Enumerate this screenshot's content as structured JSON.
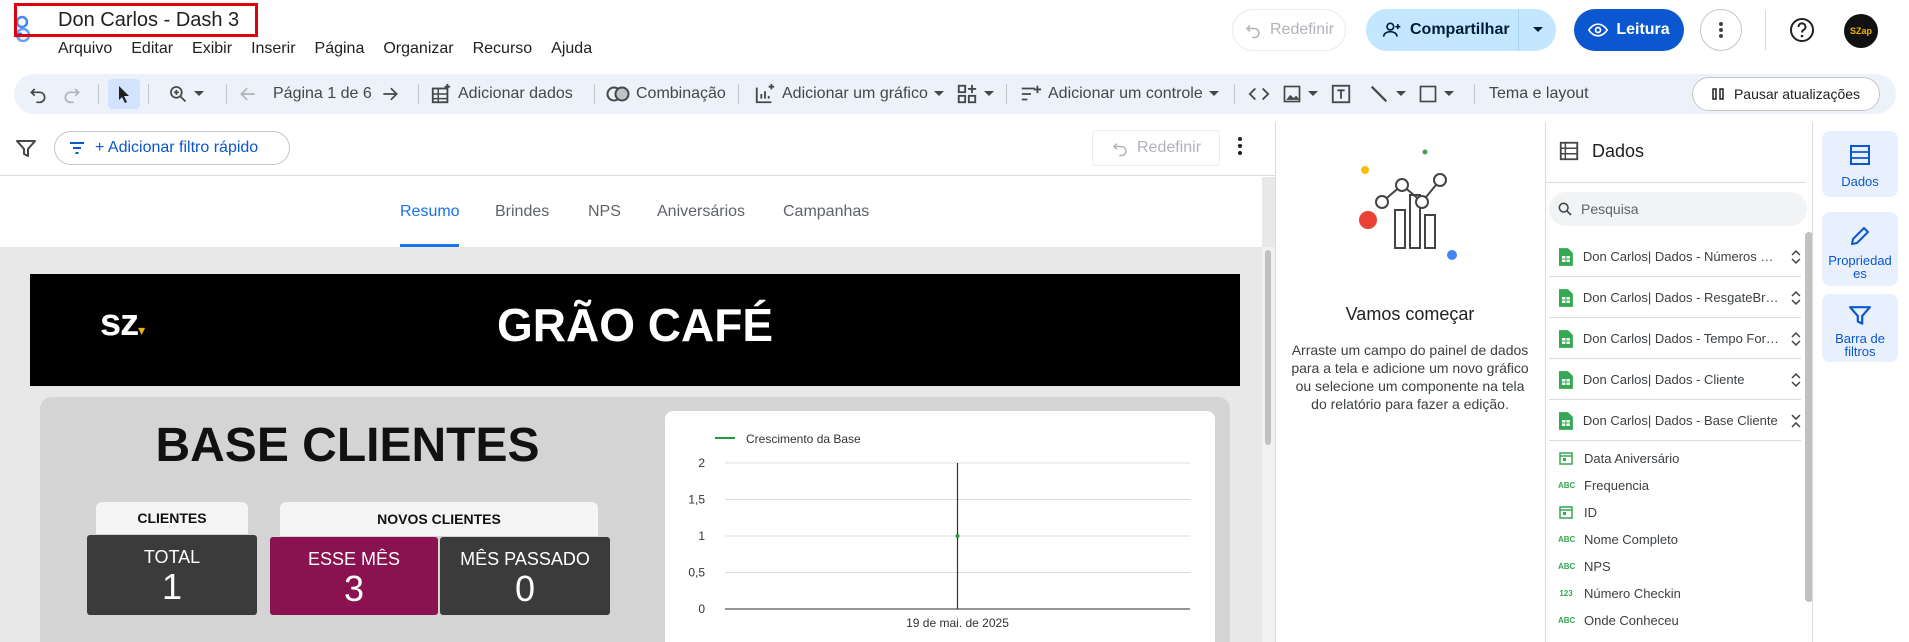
{
  "app": {
    "doc_title": "Don Carlos - Dash 3",
    "menu": [
      "Arquivo",
      "Editar",
      "Exibir",
      "Inserir",
      "Página",
      "Organizar",
      "Recurso",
      "Ajuda"
    ],
    "reset_label": "Redefinir",
    "share_label": "Compartilhar",
    "read_label": "Leitura",
    "avatar_text": "SZap"
  },
  "toolbar": {
    "page_indicator": "Página 1 de 6",
    "add_data": "Adicionar dados",
    "blend": "Combinação",
    "add_chart": "Adicionar um gráfico",
    "add_control": "Adicionar um controle",
    "theme_layout": "Tema e layout",
    "pause_updates": "Pausar atualizações"
  },
  "filterbar": {
    "quick_filter": "+ Adicionar filtro rápido",
    "reset_label": "Redefinir"
  },
  "report": {
    "tabs": [
      "Resumo",
      "Brindes",
      "NPS",
      "Aniversários",
      "Campanhas"
    ],
    "active_tab": "Resumo",
    "banner_logo": "sz",
    "banner_title": "GRÃO CAFÉ",
    "section_title": "BASE CLIENTES",
    "clients_label": "CLIENTES",
    "new_clients_label": "NOVOS CLIENTES",
    "kpis": [
      {
        "label": "TOTAL",
        "value": "1",
        "color": "#3b3b3b"
      },
      {
        "label": "ESSE MÊS",
        "value": "3",
        "color": "#8b1250"
      },
      {
        "label": "MÊS PASSADO",
        "value": "0",
        "color": "#3b3b3b"
      }
    ]
  },
  "chart_data": {
    "type": "line",
    "series": [
      {
        "name": "Crescimento da Base",
        "color": "#1e9e3a",
        "x": [
          "19 de mai. de 2025"
        ],
        "values": [
          1
        ]
      }
    ],
    "x": [
      "19 de mai. de 2025"
    ],
    "y_ticks": [
      "0",
      "0,5",
      "1",
      "1,5",
      "2"
    ],
    "ylim": [
      0,
      2
    ],
    "grid": true,
    "legend": "top-left"
  },
  "middle_panel": {
    "heading": "Vamos começar",
    "text": "Arraste um campo do painel de dados para a tela e adicione um novo gráfico ou selecione um componente na tela do relatório para fazer a edição."
  },
  "data_panel": {
    "title": "Dados",
    "search_placeholder": "Pesquisa",
    "sources": [
      "Don Carlos| Dados - Números Cadastrados",
      "Don Carlos| Dados - ResgateBrindes",
      "Don Carlos| Dados - Tempo Formulário",
      "Don Carlos| Dados - Cliente",
      "Don Carlos| Dados - Base Cliente"
    ],
    "fields": [
      {
        "type": "date",
        "name": "Data Aniversário"
      },
      {
        "type": "ABC",
        "name": "Frequencia"
      },
      {
        "type": "date",
        "name": "ID"
      },
      {
        "type": "ABC",
        "name": "Nome Completo"
      },
      {
        "type": "ABC",
        "name": "NPS"
      },
      {
        "type": "123",
        "name": "Número Checkin"
      },
      {
        "type": "ABC",
        "name": "Onde Conheceu"
      }
    ]
  },
  "rail": {
    "data": "Dados",
    "properties": "Propriedad es",
    "filter_bar": "Barra de filtros"
  },
  "colors": {
    "accent": "#0b57d0",
    "share_bg": "#c2e7ff",
    "sheets_green": "#34a853"
  }
}
